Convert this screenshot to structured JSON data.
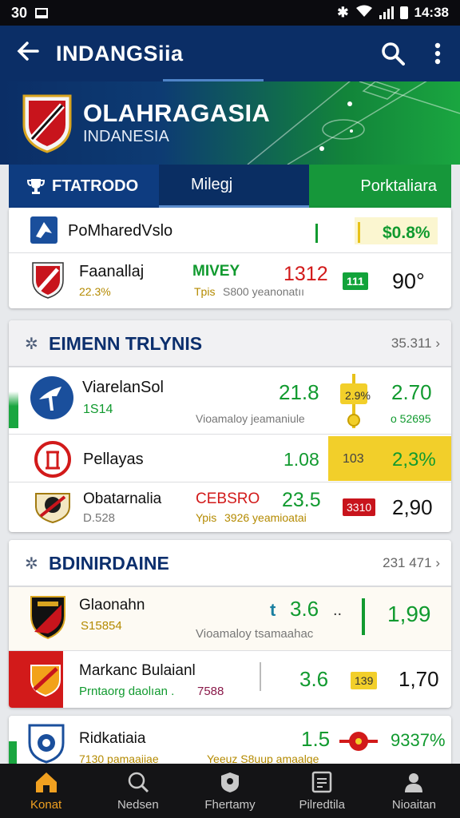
{
  "status_bar": {
    "left": "30",
    "time": "14:38",
    "icons": [
      "photo-icon",
      "bluetooth-icon",
      "wifi-icon",
      "signal-icon",
      "battery-icon"
    ]
  },
  "app_bar": {
    "title": "INDANGSiia",
    "back_icon": "back-arrow-icon",
    "search_icon": "search-icon",
    "more_icon": "more-vert-icon"
  },
  "hero": {
    "title": "OLAHRAGASIA",
    "subtitle": "INDANESIA"
  },
  "tabs": [
    {
      "label": "FTATRODO",
      "icon": "trophy-icon"
    },
    {
      "label": "Milegj"
    },
    {
      "label": "Porktaliara"
    }
  ],
  "top_card": {
    "rows": [
      {
        "name": "PoMharedVslo",
        "value": "$0.8%"
      },
      {
        "name": "Faanallaj",
        "sub": "22.3%",
        "status": "MIVEY",
        "status_sub": "Tpis",
        "detail": "S800 yeanonatıı",
        "score": "1312",
        "badge": "111",
        "value": "90°"
      }
    ]
  },
  "section1": {
    "title": "EIMENN TRLYNIS",
    "count": "35.311",
    "rows": [
      {
        "name": "ViarelanSol",
        "sub": "1S14",
        "detail": "Vioamaloy jeamaniule",
        "score": "21.8",
        "badge": "2.9%",
        "value": "2.70",
        "value_sub": "o 52695"
      },
      {
        "name": "Pellayas",
        "score": "1.08",
        "badge": "103",
        "value": "2,3%"
      },
      {
        "name": "Obatarnalia",
        "sub": "D.528",
        "status": "CEBSRO",
        "status_sub": "Ypis",
        "detail": "3926 yeamioatai",
        "score": "23.5",
        "badge": "3310",
        "value": "2,90"
      }
    ]
  },
  "section2": {
    "title": "BDINIRDAINE",
    "count": "231 471",
    "rows": [
      {
        "name": "Glaonahn",
        "sub": "S15854",
        "detail": "Vioamaloy tsamaahac",
        "score": "3.6",
        "mark": "t",
        "dots": "..",
        "value": "1,99"
      },
      {
        "name": "Markanc Bulaianl",
        "sub": "Prntaorg daolıan .",
        "sub2": "7588",
        "score": "3.6",
        "badge": "139",
        "value": "1,70"
      }
    ]
  },
  "section3": {
    "rows": [
      {
        "name": "Ridkatiaia",
        "sub": "7130 pamaaiiae",
        "detail": "Yeeuz S8uup amaalqe",
        "score": "1.5",
        "value": "9337%"
      }
    ]
  },
  "bottom_nav": [
    {
      "label": "Konat",
      "icon": "home-icon",
      "active": true
    },
    {
      "label": "Nedsen",
      "icon": "search-icon"
    },
    {
      "label": "Fhertamy",
      "icon": "shield-icon"
    },
    {
      "label": "Pilredtila",
      "icon": "document-icon"
    },
    {
      "label": "Nioaitan",
      "icon": "profile-icon"
    }
  ],
  "colors": {
    "navy": "#0b2e66",
    "green": "#119a2f",
    "red": "#d21a1a",
    "yellow": "#f2cf2a"
  }
}
